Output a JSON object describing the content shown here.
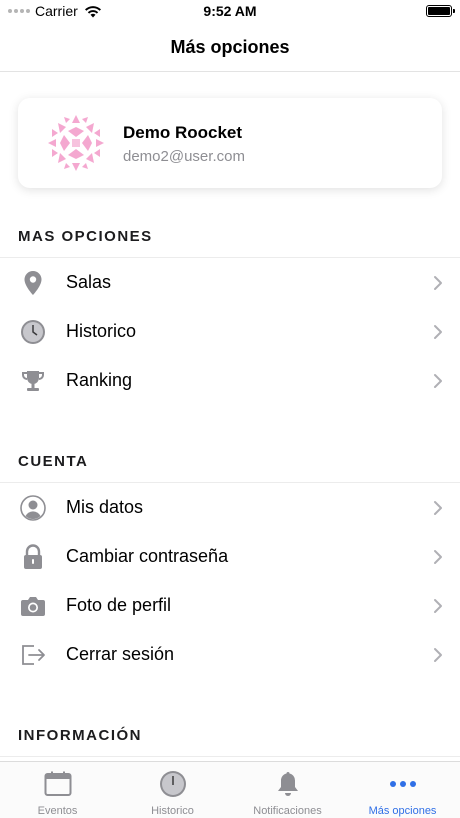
{
  "status_bar": {
    "carrier": "Carrier",
    "time": "9:52 AM"
  },
  "nav": {
    "title": "Más opciones"
  },
  "profile": {
    "name": "Demo Roocket",
    "email": "demo2@user.com"
  },
  "sections": {
    "more_options": {
      "header": "MAS OPCIONES",
      "items": [
        {
          "label": "Salas",
          "icon": "location-pin-icon"
        },
        {
          "label": "Historico",
          "icon": "clock-icon"
        },
        {
          "label": "Ranking",
          "icon": "trophy-icon"
        }
      ]
    },
    "account": {
      "header": "CUENTA",
      "items": [
        {
          "label": "Mis datos",
          "icon": "user-icon"
        },
        {
          "label": "Cambiar contraseña",
          "icon": "lock-icon"
        },
        {
          "label": "Foto de perfil",
          "icon": "camera-icon"
        },
        {
          "label": "Cerrar sesión",
          "icon": "logout-icon"
        }
      ]
    },
    "information": {
      "header": "INFORMACIÓN"
    }
  },
  "tab_bar": {
    "tabs": [
      {
        "label": "Eventos",
        "icon": "calendar-icon"
      },
      {
        "label": "Historico",
        "icon": "clock-icon"
      },
      {
        "label": "Notificaciones",
        "icon": "bell-icon"
      },
      {
        "label": "Más opciones",
        "icon": "more-dots-icon",
        "active": true
      }
    ]
  },
  "colors": {
    "accent": "#2f6fe6",
    "icon_gray": "#8e8e93",
    "avatar_pink": "#f4a8d0"
  }
}
